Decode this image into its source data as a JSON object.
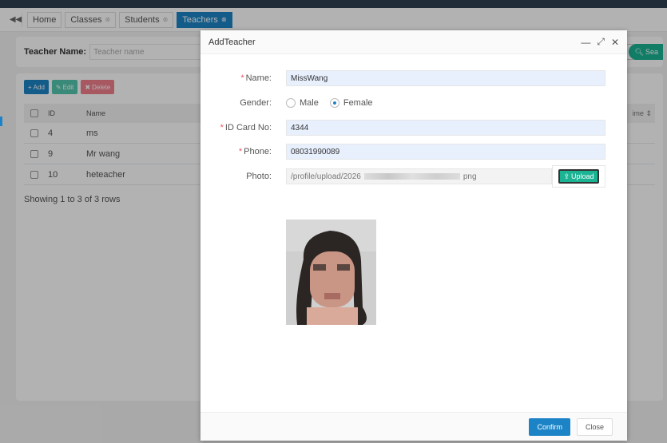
{
  "tabs": {
    "items": [
      {
        "label": "Home",
        "active": false,
        "closable": false
      },
      {
        "label": "Classes",
        "active": false,
        "closable": true
      },
      {
        "label": "Students",
        "active": false,
        "closable": true
      },
      {
        "label": "Teachers",
        "active": true,
        "closable": true
      }
    ]
  },
  "search": {
    "label": "Teacher Name:",
    "placeholder": "Teacher name",
    "search_button": "Sea"
  },
  "toolbar": {
    "add_label": "Add",
    "edit_label": "Edit",
    "delete_label": "Delete"
  },
  "table": {
    "columns": [
      "ID",
      "Name"
    ],
    "right_header": "ime",
    "rows": [
      {
        "id": "4",
        "name": "ms"
      },
      {
        "id": "9",
        "name": "Mr wang"
      },
      {
        "id": "10",
        "name": "heteacher"
      }
    ],
    "showing": "Showing 1 to 3 of 3 rows"
  },
  "modal": {
    "title": "AddTeacher",
    "fields": {
      "name_label": "Name:",
      "name_value": "MissWang",
      "gender_label": "Gender:",
      "gender_options": [
        "Male",
        "Female"
      ],
      "gender_selected": "Female",
      "idcard_label": "ID Card No:",
      "idcard_value": "4344",
      "phone_label": "Phone:",
      "phone_value": "08031990089",
      "photo_label": "Photo:",
      "photo_value_start": "/profile/upload/2026",
      "photo_value_end": "png",
      "upload_label": "Upload"
    },
    "confirm_label": "Confirm",
    "close_label": "Close"
  },
  "colors": {
    "primary": "#1c84c6",
    "success": "#1ab394",
    "danger": "#ed5565"
  }
}
